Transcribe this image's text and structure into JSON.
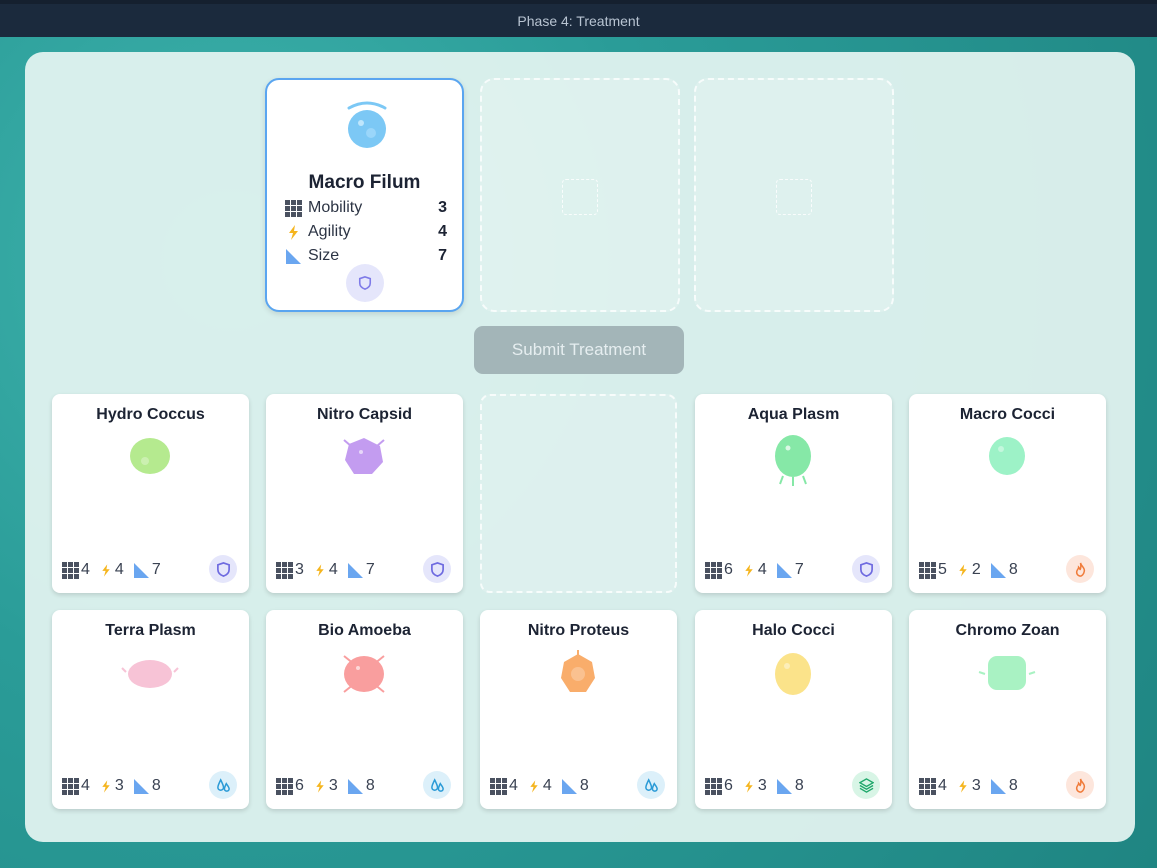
{
  "header": {
    "title": "Phase 4: Treatment"
  },
  "selected": {
    "name": "Macro Filum",
    "color": "#7cc8f5",
    "badge": "shield-icon",
    "stats": [
      {
        "label": "Mobility",
        "value": "3",
        "icon": "grid-icon"
      },
      {
        "label": "Agility",
        "value": "4",
        "icon": "bolt-icon"
      },
      {
        "label": "Size",
        "value": "7",
        "icon": "ruler-triangle-icon"
      }
    ]
  },
  "submit": {
    "label": "Submit Treatment"
  },
  "cards": [
    {
      "name": "Hydro Coccus",
      "mobility": "4",
      "agility": "4",
      "size": "7",
      "badge": "shield-icon",
      "color": "#b5ea8f"
    },
    {
      "name": "Nitro Capsid",
      "mobility": "3",
      "agility": "4",
      "size": "7",
      "badge": "shield-icon",
      "color": "#c39cf0"
    },
    {
      "name": "Aqua Plasm",
      "mobility": "6",
      "agility": "4",
      "size": "7",
      "badge": "shield-icon",
      "color": "#86e8a7"
    },
    {
      "name": "Macro Cocci",
      "mobility": "5",
      "agility": "2",
      "size": "8",
      "badge": "fire-icon",
      "color": "#9df2c7"
    },
    {
      "name": "Terra Plasm",
      "mobility": "4",
      "agility": "3",
      "size": "8",
      "badge": "water-drops-icon",
      "color": "#f7c3d6"
    },
    {
      "name": "Bio Amoeba",
      "mobility": "6",
      "agility": "3",
      "size": "8",
      "badge": "water-drops-icon",
      "color": "#f99e9e"
    },
    {
      "name": "Nitro Proteus",
      "mobility": "4",
      "agility": "4",
      "size": "8",
      "badge": "water-drops-icon",
      "color": "#f9ad6b"
    },
    {
      "name": "Halo Cocci",
      "mobility": "6",
      "agility": "3",
      "size": "8",
      "badge": "layers-icon",
      "color": "#fbe38a"
    },
    {
      "name": "Chromo Zoan",
      "mobility": "4",
      "agility": "3",
      "size": "8",
      "badge": "fire-icon",
      "color": "#a9f2c3"
    }
  ]
}
